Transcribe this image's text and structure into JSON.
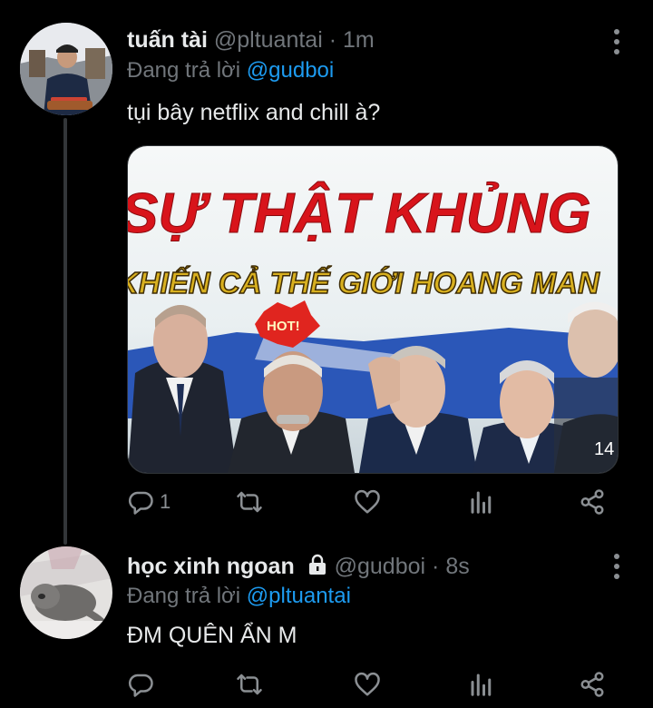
{
  "tweet1": {
    "name": "tuấn tài",
    "handle": "@pltuantai",
    "separator": "·",
    "time": "1m",
    "replying_prefix": "Đang trả lời",
    "replying_to": "@gudboi",
    "text": "tụi bây netflix and chill à?",
    "reply_count": "1",
    "image_text": {
      "headline": "SỰ THẬT KHỦNG",
      "subheadline": "KHIẾN CẢ THẾ GIỚI HOANG MAN",
      "badge": "HOT!",
      "corner_number": "14"
    }
  },
  "tweet2": {
    "name": "học xinh ngoan",
    "handle": "@gudboi",
    "separator": "·",
    "time": "8s",
    "replying_prefix": "Đang trả lời",
    "replying_to": "@pltuantai",
    "text": "ĐM QUÊN ẨN M",
    "reply_count": ""
  },
  "colors": {
    "background": "#000000",
    "text": "#e7e9ea",
    "muted": "#71767b",
    "link": "#1d9bf0",
    "headline_red": "#d8141b",
    "subheadline_gold": "#d8b020"
  },
  "icons": [
    "more-icon",
    "reply-icon",
    "retweet-icon",
    "like-icon",
    "views-icon",
    "share-icon",
    "lock-icon"
  ]
}
